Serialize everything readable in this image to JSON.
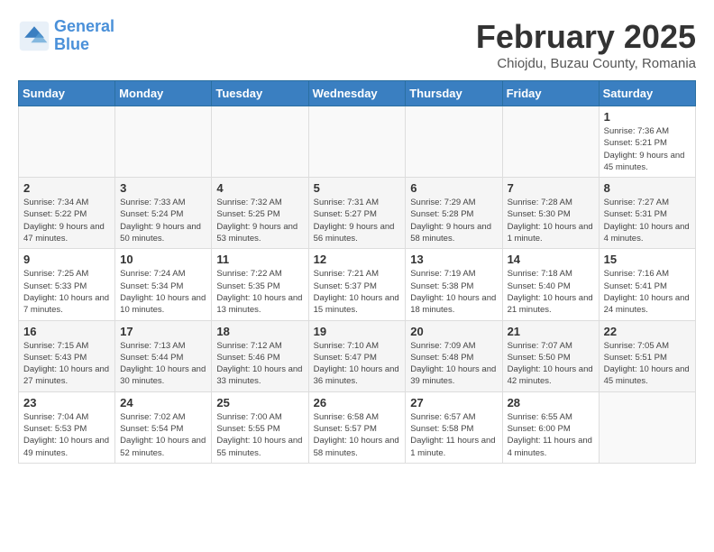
{
  "header": {
    "logo_line1": "General",
    "logo_line2": "Blue",
    "month": "February 2025",
    "location": "Chiojdu, Buzau County, Romania"
  },
  "days_of_week": [
    "Sunday",
    "Monday",
    "Tuesday",
    "Wednesday",
    "Thursday",
    "Friday",
    "Saturday"
  ],
  "weeks": [
    [
      {
        "day": "",
        "info": ""
      },
      {
        "day": "",
        "info": ""
      },
      {
        "day": "",
        "info": ""
      },
      {
        "day": "",
        "info": ""
      },
      {
        "day": "",
        "info": ""
      },
      {
        "day": "",
        "info": ""
      },
      {
        "day": "1",
        "info": "Sunrise: 7:36 AM\nSunset: 5:21 PM\nDaylight: 9 hours and 45 minutes."
      }
    ],
    [
      {
        "day": "2",
        "info": "Sunrise: 7:34 AM\nSunset: 5:22 PM\nDaylight: 9 hours and 47 minutes."
      },
      {
        "day": "3",
        "info": "Sunrise: 7:33 AM\nSunset: 5:24 PM\nDaylight: 9 hours and 50 minutes."
      },
      {
        "day": "4",
        "info": "Sunrise: 7:32 AM\nSunset: 5:25 PM\nDaylight: 9 hours and 53 minutes."
      },
      {
        "day": "5",
        "info": "Sunrise: 7:31 AM\nSunset: 5:27 PM\nDaylight: 9 hours and 56 minutes."
      },
      {
        "day": "6",
        "info": "Sunrise: 7:29 AM\nSunset: 5:28 PM\nDaylight: 9 hours and 58 minutes."
      },
      {
        "day": "7",
        "info": "Sunrise: 7:28 AM\nSunset: 5:30 PM\nDaylight: 10 hours and 1 minute."
      },
      {
        "day": "8",
        "info": "Sunrise: 7:27 AM\nSunset: 5:31 PM\nDaylight: 10 hours and 4 minutes."
      }
    ],
    [
      {
        "day": "9",
        "info": "Sunrise: 7:25 AM\nSunset: 5:33 PM\nDaylight: 10 hours and 7 minutes."
      },
      {
        "day": "10",
        "info": "Sunrise: 7:24 AM\nSunset: 5:34 PM\nDaylight: 10 hours and 10 minutes."
      },
      {
        "day": "11",
        "info": "Sunrise: 7:22 AM\nSunset: 5:35 PM\nDaylight: 10 hours and 13 minutes."
      },
      {
        "day": "12",
        "info": "Sunrise: 7:21 AM\nSunset: 5:37 PM\nDaylight: 10 hours and 15 minutes."
      },
      {
        "day": "13",
        "info": "Sunrise: 7:19 AM\nSunset: 5:38 PM\nDaylight: 10 hours and 18 minutes."
      },
      {
        "day": "14",
        "info": "Sunrise: 7:18 AM\nSunset: 5:40 PM\nDaylight: 10 hours and 21 minutes."
      },
      {
        "day": "15",
        "info": "Sunrise: 7:16 AM\nSunset: 5:41 PM\nDaylight: 10 hours and 24 minutes."
      }
    ],
    [
      {
        "day": "16",
        "info": "Sunrise: 7:15 AM\nSunset: 5:43 PM\nDaylight: 10 hours and 27 minutes."
      },
      {
        "day": "17",
        "info": "Sunrise: 7:13 AM\nSunset: 5:44 PM\nDaylight: 10 hours and 30 minutes."
      },
      {
        "day": "18",
        "info": "Sunrise: 7:12 AM\nSunset: 5:46 PM\nDaylight: 10 hours and 33 minutes."
      },
      {
        "day": "19",
        "info": "Sunrise: 7:10 AM\nSunset: 5:47 PM\nDaylight: 10 hours and 36 minutes."
      },
      {
        "day": "20",
        "info": "Sunrise: 7:09 AM\nSunset: 5:48 PM\nDaylight: 10 hours and 39 minutes."
      },
      {
        "day": "21",
        "info": "Sunrise: 7:07 AM\nSunset: 5:50 PM\nDaylight: 10 hours and 42 minutes."
      },
      {
        "day": "22",
        "info": "Sunrise: 7:05 AM\nSunset: 5:51 PM\nDaylight: 10 hours and 45 minutes."
      }
    ],
    [
      {
        "day": "23",
        "info": "Sunrise: 7:04 AM\nSunset: 5:53 PM\nDaylight: 10 hours and 49 minutes."
      },
      {
        "day": "24",
        "info": "Sunrise: 7:02 AM\nSunset: 5:54 PM\nDaylight: 10 hours and 52 minutes."
      },
      {
        "day": "25",
        "info": "Sunrise: 7:00 AM\nSunset: 5:55 PM\nDaylight: 10 hours and 55 minutes."
      },
      {
        "day": "26",
        "info": "Sunrise: 6:58 AM\nSunset: 5:57 PM\nDaylight: 10 hours and 58 minutes."
      },
      {
        "day": "27",
        "info": "Sunrise: 6:57 AM\nSunset: 5:58 PM\nDaylight: 11 hours and 1 minute."
      },
      {
        "day": "28",
        "info": "Sunrise: 6:55 AM\nSunset: 6:00 PM\nDaylight: 11 hours and 4 minutes."
      },
      {
        "day": "",
        "info": ""
      }
    ]
  ]
}
